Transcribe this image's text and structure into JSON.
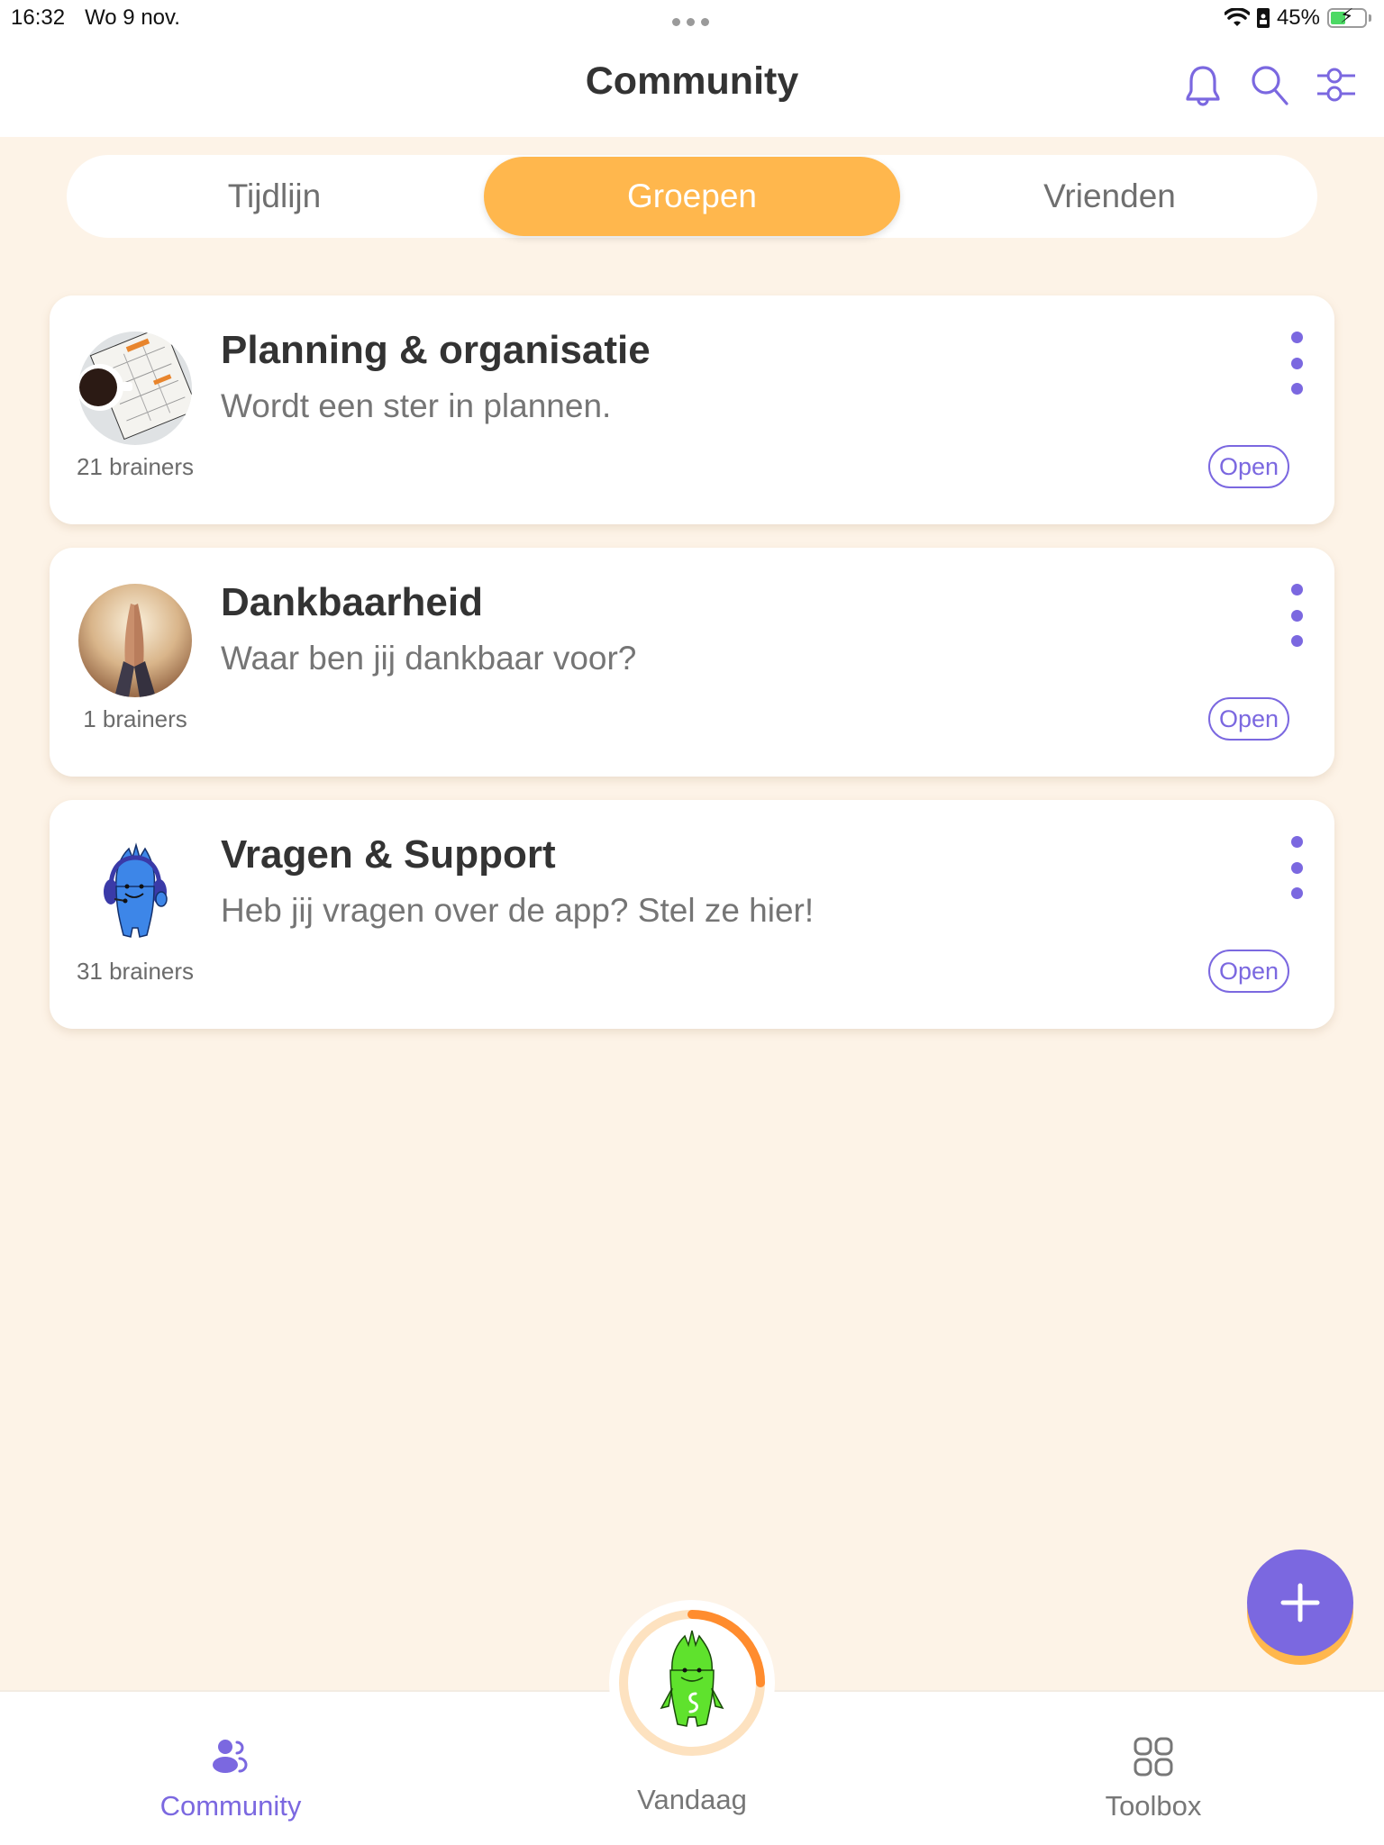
{
  "status_bar": {
    "time": "16:32",
    "date": "Wo 9 nov.",
    "battery_percent": "45%",
    "battery_level": 0.45,
    "icons": [
      "wifi-icon",
      "portrait-lock-icon",
      "battery-charging-icon"
    ]
  },
  "header": {
    "title": "Community",
    "icons": [
      "bell-icon",
      "search-icon",
      "filter-sliders-icon"
    ]
  },
  "tabs": [
    {
      "label": "Tijdlijn",
      "active": false
    },
    {
      "label": "Groepen",
      "active": true
    },
    {
      "label": "Vrienden",
      "active": false
    }
  ],
  "groups": [
    {
      "title": "Planning & organisatie",
      "subtitle": "Wordt een ster in plannen.",
      "members": "21 brainers",
      "open_label": "Open",
      "avatar": "planner-coffee-photo"
    },
    {
      "title": "Dankbaarheid",
      "subtitle": "Waar ben jij dankbaar voor?",
      "members": "1 brainers",
      "open_label": "Open",
      "avatar": "praying-hands-photo"
    },
    {
      "title": "Vragen & Support",
      "subtitle": "Heb jij vragen over de app? Stel ze hier!",
      "members": "31 brainers",
      "open_label": "Open",
      "avatar": "blue-mascot-headset"
    }
  ],
  "fab": {
    "icon": "plus-icon"
  },
  "bottom_nav": {
    "items": [
      {
        "label": "Community",
        "icon": "community-icon",
        "active": true
      },
      {
        "label": "Vandaag",
        "icon": "green-mascot",
        "active": false,
        "progress": 0.25
      },
      {
        "label": "Toolbox",
        "icon": "grid-icon",
        "active": false
      }
    ]
  },
  "colors": {
    "accent": "#7b68e0",
    "tab_active": "#ffb74d",
    "background": "#fdf3e7",
    "progress": "#ff8c2e",
    "progress_track": "#fde2c0"
  }
}
